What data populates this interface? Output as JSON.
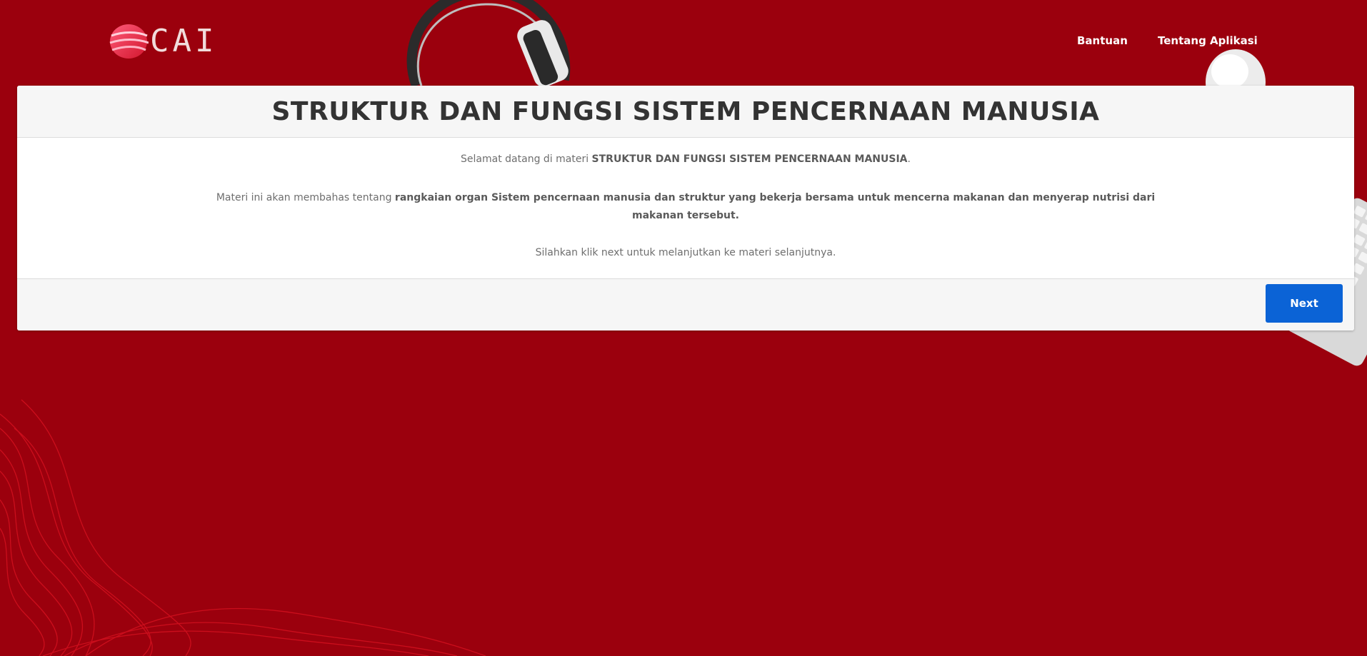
{
  "header": {
    "logo_text": "CAI",
    "nav": [
      {
        "label": "Bantuan"
      },
      {
        "label": "Tentang Aplikasi"
      }
    ]
  },
  "card": {
    "title": "STRUKTUR DAN FUNGSI SISTEM PENCERNAAN MANUSIA",
    "welcome_prefix": "Selamat datang di materi ",
    "welcome_bold": "STRUKTUR DAN FUNGSI SISTEM PENCERNAAN MANUSIA",
    "welcome_suffix": ".",
    "desc_prefix": "Materi ini akan membahas tentang ",
    "desc_bold_line1": "rangkaian organ Sistem pencernaan manusia dan struktur yang bekerja bersama untuk mencerna makanan dan menyerap nutrisi dari",
    "desc_bold_line2": "makanan tersebut.",
    "instruction": "Silahkan klik next untuk melanjutkan ke materi selanjutnya.",
    "next_label": "Next"
  },
  "colors": {
    "background": "#9b000d",
    "button": "#0b63d6"
  }
}
